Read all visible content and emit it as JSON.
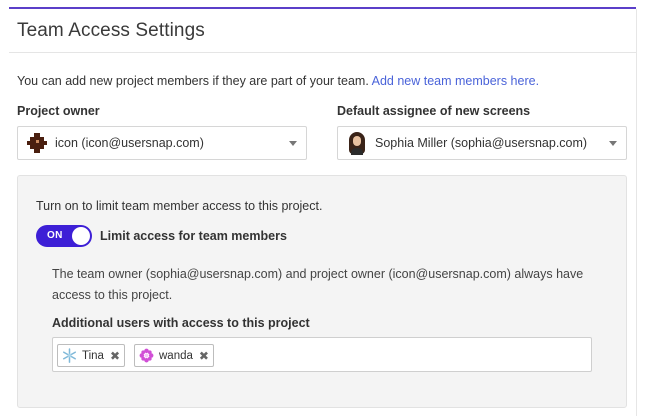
{
  "page": {
    "title": "Team Access Settings",
    "intro_text": "You can add new project members if they are part of your team.",
    "intro_link": "Add new team members here."
  },
  "project_owner": {
    "label": "Project owner",
    "value": "icon (icon@usersnap.com)",
    "icon": "pixel-logo-icon"
  },
  "default_assignee": {
    "label": "Default assignee of new screens",
    "value": "Sophia Miller (sophia@usersnap.com)",
    "icon": "user-avatar"
  },
  "access_panel": {
    "intro": "Turn on to limit team member access to this project.",
    "toggle_state": "ON",
    "toggle_label": "Limit access for team members",
    "note": "The team owner (sophia@usersnap.com) and project owner (icon@usersnap.com) always have access to this project.",
    "additional_label": "Additional users with access to this project",
    "users": [
      {
        "name": "Tina",
        "remove": "✖",
        "icon_color": "#7fb8d8"
      },
      {
        "name": "wanda",
        "remove": "✖",
        "icon_color": "#d14fd6"
      }
    ]
  },
  "colors": {
    "accent": "#3d1fd6",
    "link": "#4a63d9",
    "top_border": "#5b3fc9"
  }
}
